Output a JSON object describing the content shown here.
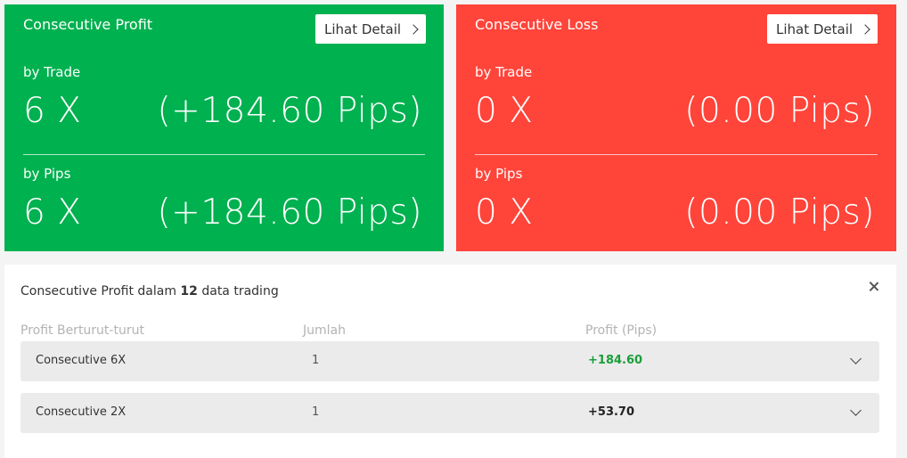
{
  "profit_card": {
    "title": "Consecutive Profit",
    "button": "Lihat Detail",
    "by_trade_label": "by Trade",
    "by_trade_count": "6 X",
    "by_trade_pips": "(+184.60 Pips)",
    "by_pips_label": "by Pips",
    "by_pips_count": "6 X",
    "by_pips_pips": "(+184.60 Pips)",
    "color": "#00b14f"
  },
  "loss_card": {
    "title": "Consecutive Loss",
    "button": "Lihat Detail",
    "by_trade_label": "by Trade",
    "by_trade_count": "0 X",
    "by_trade_pips": "(0.00 Pips)",
    "by_pips_label": "by Pips",
    "by_pips_count": "0 X",
    "by_pips_pips": "(0.00 Pips)",
    "color": "#ff443a"
  },
  "detail_panel": {
    "title_prefix": "Consecutive Profit dalam ",
    "title_count": "12",
    "title_suffix": " data trading",
    "headers": [
      "Profit Berturut-turut",
      "Jumlah",
      "Profit (Pips)"
    ],
    "rows": [
      {
        "name": "Consecutive 6X",
        "count": "1",
        "profit": "+184.60",
        "profit_color": "#1a9e3a"
      },
      {
        "name": "Consecutive 2X",
        "count": "1",
        "profit": "+53.70",
        "profit_color": "#222222"
      }
    ]
  }
}
